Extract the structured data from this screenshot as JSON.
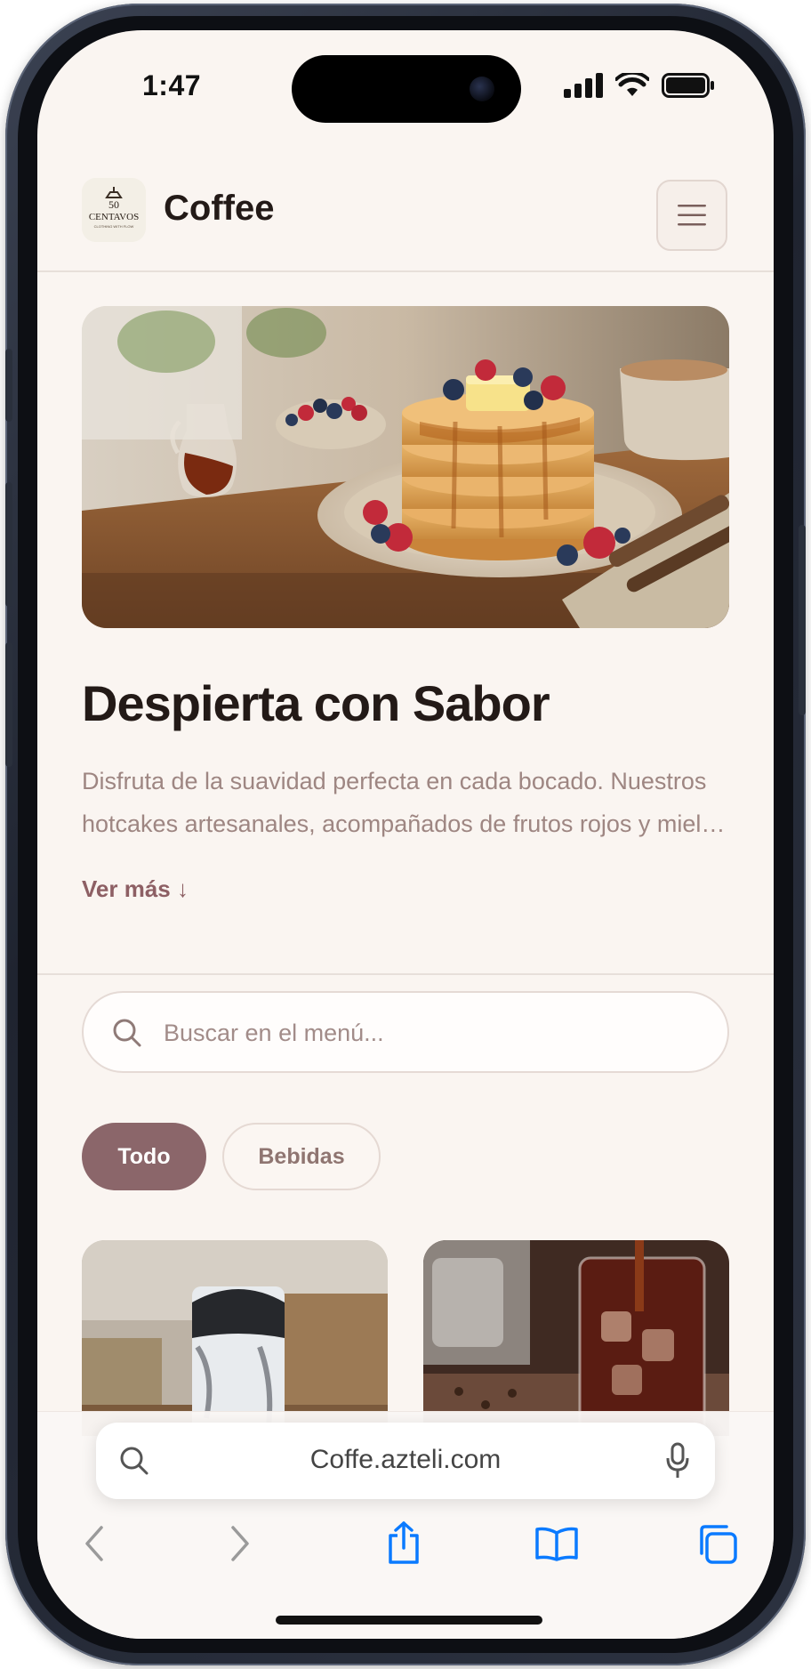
{
  "status_bar": {
    "time": "1:47"
  },
  "header": {
    "brand": "Coffee",
    "logo_text_top": "50",
    "logo_text_main": "CENTAVOS",
    "logo_text_sub": "CLOTHING WITH FLOW"
  },
  "hero": {
    "title": "Despierta con Sabor",
    "description": "Disfruta de la suavidad perfecta en cada bocado. Nuestros hotcakes artesanales, acompañados de frutos rojos y miel de maple.",
    "see_more": "Ver más ↓"
  },
  "search": {
    "placeholder": "Buscar en el menú..."
  },
  "filters": [
    {
      "label": "Todo",
      "active": true
    },
    {
      "label": "Bebidas",
      "active": false
    }
  ],
  "browser": {
    "url": "Coffe.azteli.com"
  },
  "colors": {
    "accent": "#8b666a",
    "background": "#faf5f1",
    "title": "#231a17",
    "muted_text": "#9e8682",
    "ios_blue": "#0a7aff"
  },
  "icons": [
    "menu-icon",
    "search-icon",
    "microphone-icon",
    "back-icon",
    "forward-icon",
    "share-icon",
    "bookmarks-icon",
    "tabs-icon"
  ]
}
